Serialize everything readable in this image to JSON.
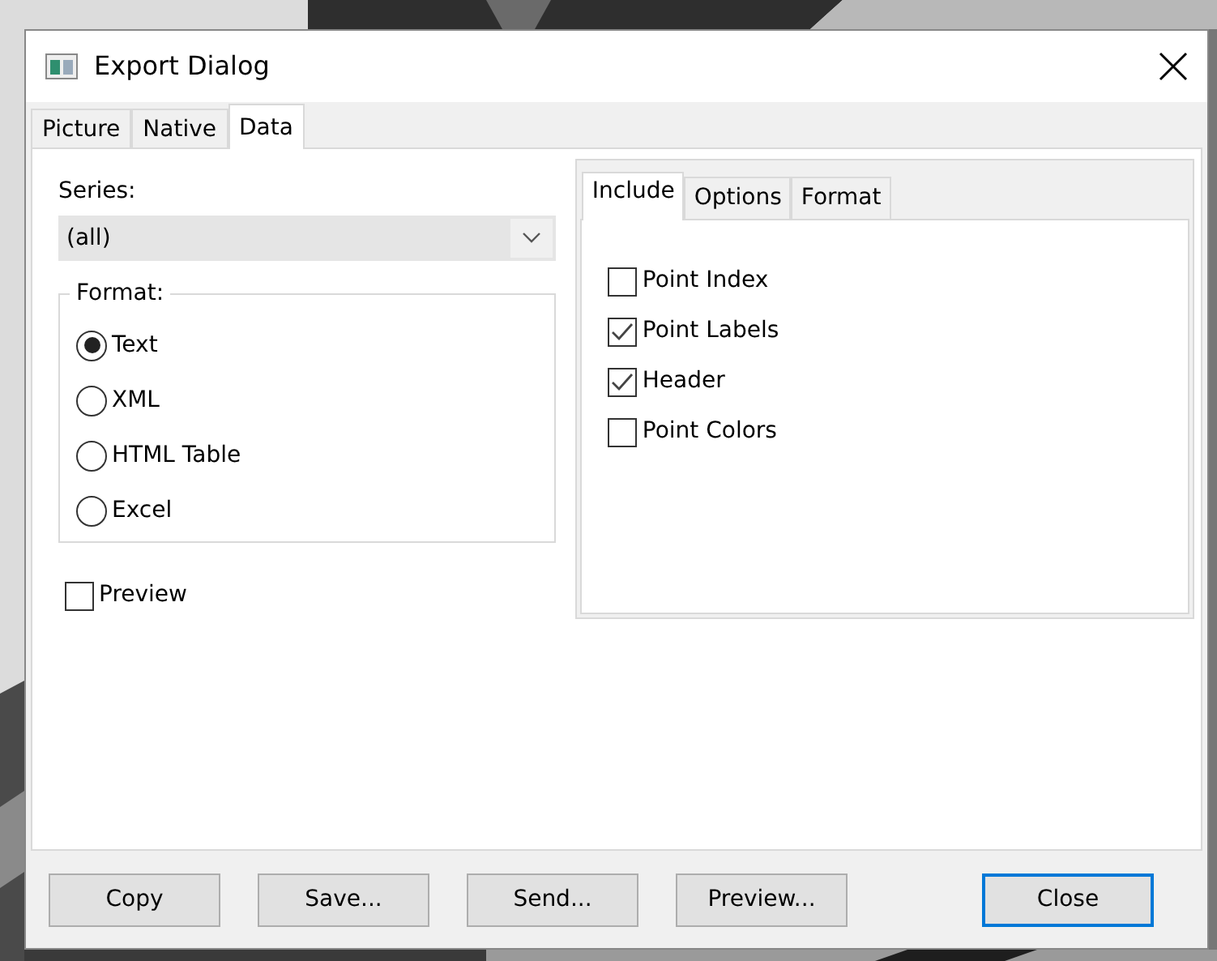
{
  "window": {
    "title": "Export Dialog"
  },
  "tabs": [
    {
      "label": "Picture",
      "selected": false
    },
    {
      "label": "Native",
      "selected": false
    },
    {
      "label": "Data",
      "selected": true
    }
  ],
  "series": {
    "label": "Series:",
    "value": "(all)"
  },
  "format_group": {
    "title": "Format:",
    "options": [
      {
        "label": "Text",
        "selected": true
      },
      {
        "label": "XML",
        "selected": false
      },
      {
        "label": "HTML Table",
        "selected": false
      },
      {
        "label": "Excel",
        "selected": false
      }
    ]
  },
  "preview": {
    "label": "Preview",
    "checked": false
  },
  "inner_tabs": [
    {
      "label": "Include",
      "selected": true
    },
    {
      "label": "Options",
      "selected": false
    },
    {
      "label": "Format",
      "selected": false
    }
  ],
  "include": [
    {
      "label": "Point Index",
      "checked": false
    },
    {
      "label": "Point Labels",
      "checked": true
    },
    {
      "label": "Header",
      "checked": true
    },
    {
      "label": "Point Colors",
      "checked": false
    }
  ],
  "buttons": [
    {
      "label": "Copy",
      "default": false
    },
    {
      "label": "Save...",
      "default": false
    },
    {
      "label": "Send...",
      "default": false
    },
    {
      "label": "Preview...",
      "default": false
    },
    {
      "label": "Close",
      "default": true
    }
  ]
}
